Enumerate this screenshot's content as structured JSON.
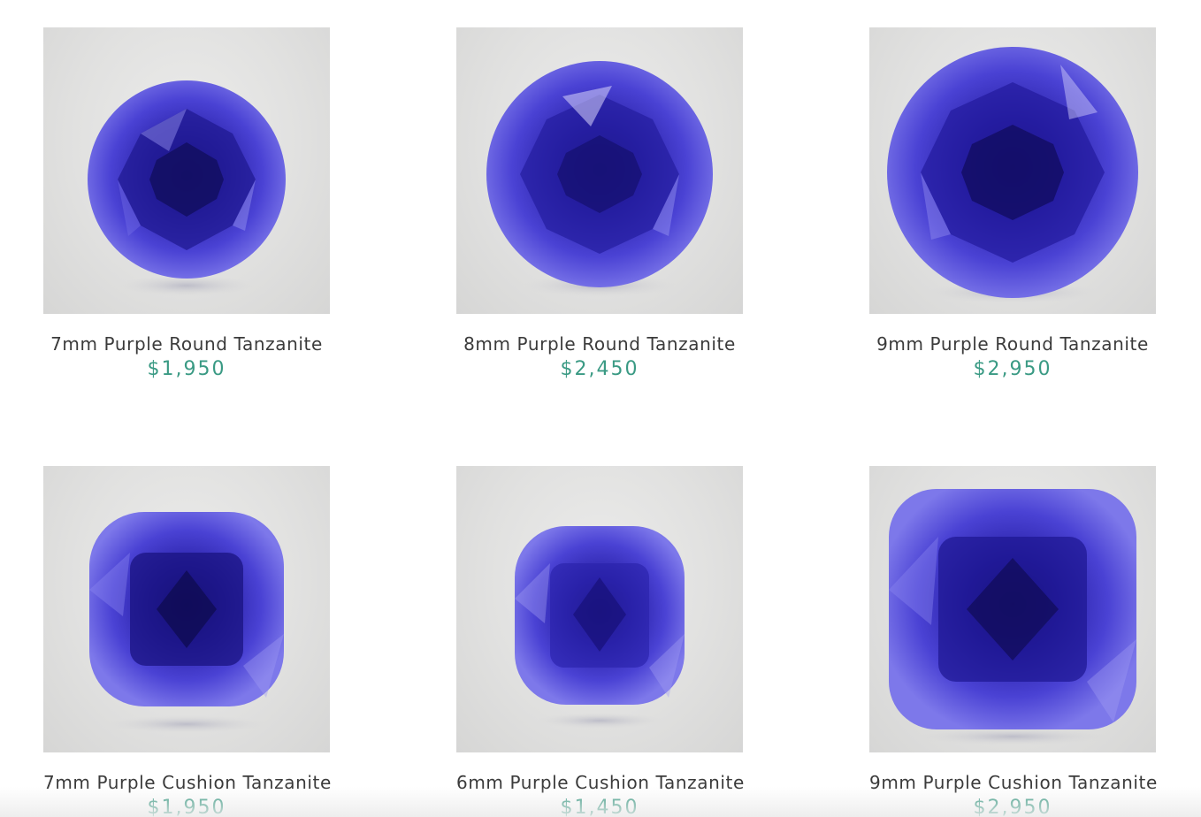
{
  "products": [
    {
      "name": "7mm Purple Round Tanzanite",
      "price": "$1,950",
      "image": "round-tanzanite-icon"
    },
    {
      "name": "8mm Purple Round Tanzanite",
      "price": "$2,450",
      "image": "round-tanzanite-icon"
    },
    {
      "name": "9mm Purple Round Tanzanite",
      "price": "$2,950",
      "image": "round-tanzanite-icon"
    },
    {
      "name": "7mm Purple Cushion Tanzanite",
      "price": "$1,950",
      "image": "cushion-tanzanite-icon"
    },
    {
      "name": "6mm Purple Cushion Tanzanite",
      "price": "$1,450",
      "image": "cushion-tanzanite-icon"
    },
    {
      "name": "9mm Purple Cushion Tanzanite",
      "price": "$2,950",
      "image": "cushion-tanzanite-icon"
    }
  ],
  "colors": {
    "price": "#3a9a84",
    "name": "#3b3b3b",
    "gem_dark": "#1a1480",
    "gem_mid": "#3d33c4",
    "gem_light": "#8a86f0"
  }
}
